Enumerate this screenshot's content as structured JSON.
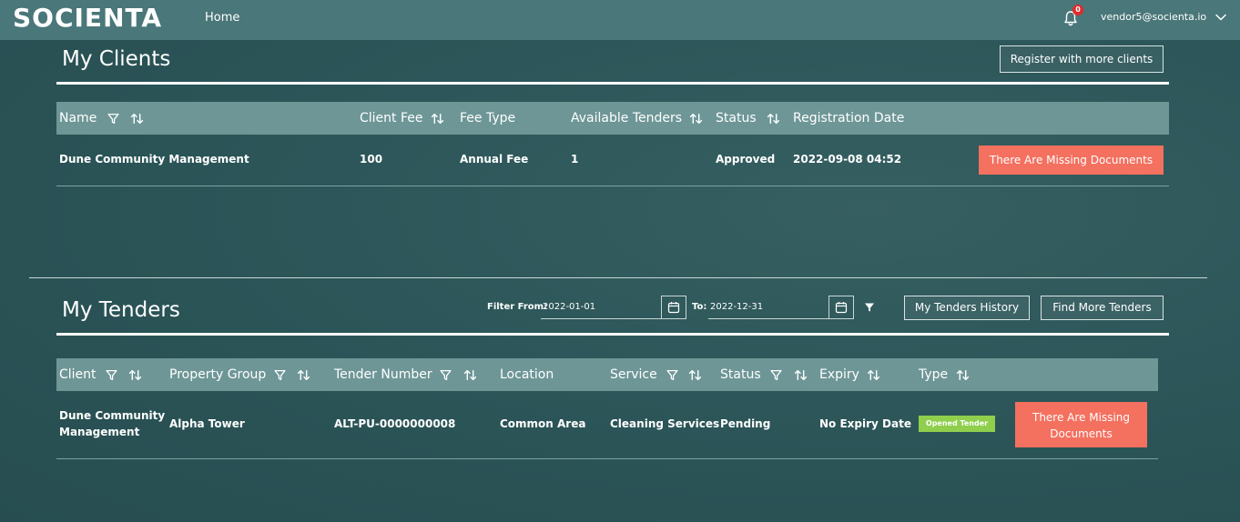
{
  "header": {
    "logo": "SOCIENTA",
    "nav_home": "Home",
    "notification_count": "0",
    "user_email": "vendor5@socienta.io"
  },
  "clients": {
    "title": "My Clients",
    "register_button": "Register with more clients",
    "columns": [
      "Name",
      "Client Fee",
      "Fee Type",
      "Available Tenders",
      "Status",
      "Registration Date"
    ],
    "rows": [
      {
        "name": "Dune Community Management",
        "client_fee": "100",
        "fee_type": "Annual Fee",
        "available_tenders": "1",
        "status": "Approved",
        "registration_date": "2022-09-08 04:52",
        "action": "There Are Missing Documents"
      }
    ]
  },
  "tenders": {
    "title": "My Tenders",
    "filter_from_label": "Filter From:",
    "filter_from_value": "2022-01-01",
    "filter_to_label": "To:",
    "filter_to_value": "2022-12-31",
    "history_button": "My Tenders History",
    "find_button": "Find More Tenders",
    "columns": [
      "Client",
      "Property Group",
      "Tender Number",
      "Location",
      "Service",
      "Status",
      "Expiry",
      "Type"
    ],
    "rows": [
      {
        "client_line1": "Dune Community",
        "client_line2": "Management",
        "property_group": "Alpha Tower",
        "tender_number": "ALT-PU-0000000008",
        "location": "Common Area",
        "service": "Cleaning Services",
        "status": "Pending",
        "expiry": "No Expiry Date",
        "type": "Opened Tender",
        "action_line1": "There Are Missing",
        "action_line2": "Documents"
      }
    ]
  },
  "colors": {
    "background": "#2c5659",
    "topbar": "#4a7779",
    "table_header": "#6e9697",
    "danger": "#f4705f",
    "success": "#8fcf4d"
  }
}
